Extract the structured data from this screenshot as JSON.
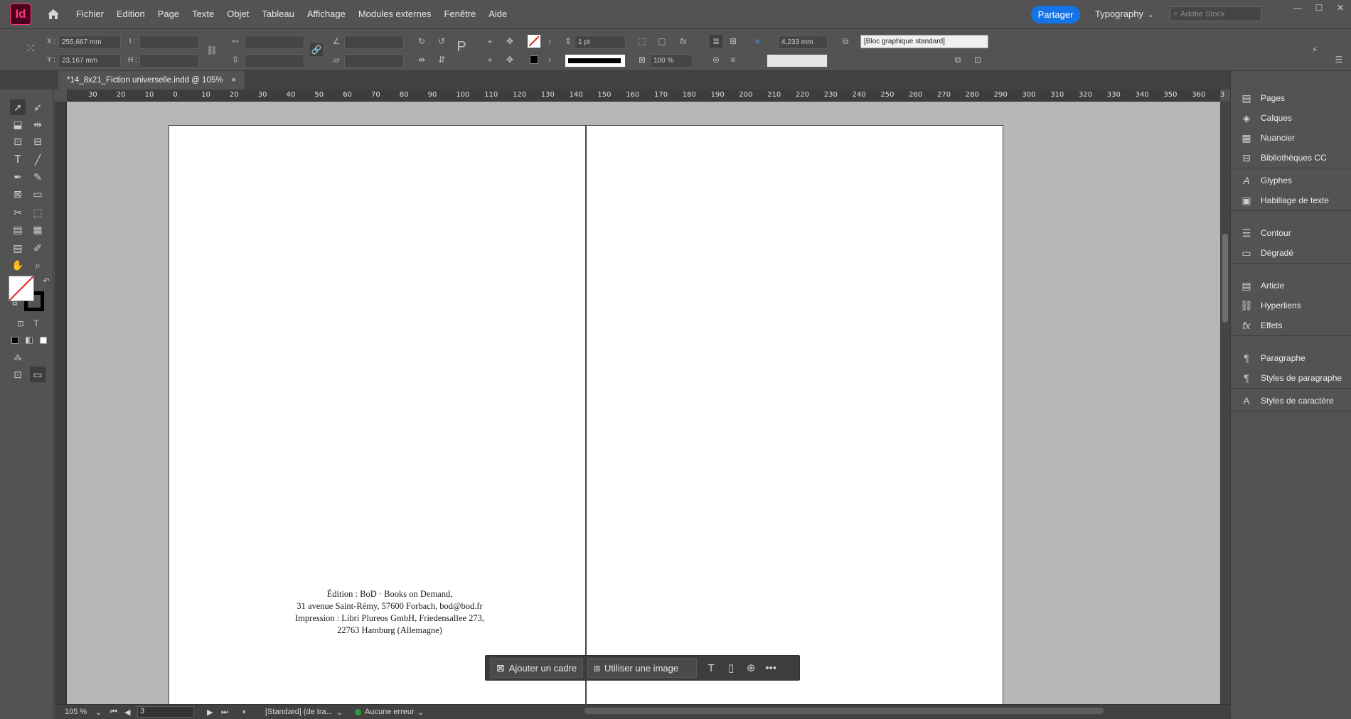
{
  "app": {
    "logo": "Id",
    "menu": [
      "Fichier",
      "Edition",
      "Page",
      "Texte",
      "Objet",
      "Tableau",
      "Affichage",
      "Modules externes",
      "Fenêtre",
      "Aide"
    ],
    "share_label": "Partager",
    "workspace_label": "Typography",
    "stock_placeholder": "Adobe Stock"
  },
  "control": {
    "x_label": "X :",
    "x_value": "255,667 mm",
    "y_label": "Y :",
    "y_value": "23,167 mm",
    "w_label": "l :",
    "h_label": "H :",
    "stroke_weight": "1 pt",
    "opacity": "100 %",
    "offset": "4,233 mm",
    "object_style": "[Bloc graphique standard]"
  },
  "tab": {
    "title": "*14_8x21_Fiction universelle.indd @ 105%",
    "close": "×"
  },
  "ruler": {
    "h_ticks": [
      "30",
      "20",
      "10",
      "0",
      "10",
      "20",
      "30",
      "40",
      "50",
      "60",
      "70",
      "80",
      "90",
      "100",
      "110",
      "120",
      "130",
      "140",
      "150",
      "160",
      "170",
      "180",
      "190",
      "200",
      "210",
      "220",
      "230",
      "240",
      "250",
      "260",
      "270",
      "280",
      "290",
      "300",
      "310",
      "320",
      "330",
      "340",
      "350",
      "360",
      "3"
    ]
  },
  "document": {
    "imprint_lines": [
      "Édition : BoD · Books on Demand,",
      "31 avenue Saint-Rémy, 57600 Forbach, bod@bod.fr",
      "Impression : Libri Plureos GmbH, Friedensallee 273,",
      "22763 Hamburg (Allemagne)"
    ]
  },
  "contextual": {
    "add_frame": "Ajouter un cadre",
    "use_image": "Utiliser une image"
  },
  "status": {
    "zoom": "105 %",
    "page": "3",
    "style": "[Standard] (de tra...",
    "preflight": "Aucune erreur"
  },
  "panels": [
    {
      "label": "Pages",
      "icon": "pages-icon"
    },
    {
      "label": "Calques",
      "icon": "layers-icon"
    },
    {
      "label": "Nuancier",
      "icon": "swatches-icon"
    },
    {
      "label": "Bibliothèques CC",
      "icon": "libraries-icon"
    },
    {
      "label": "Glyphes",
      "icon": "glyphs-icon"
    },
    {
      "label": "Habillage de texte",
      "icon": "text-wrap-icon"
    },
    {
      "label": "Contour",
      "icon": "stroke-icon"
    },
    {
      "label": "Dégradé",
      "icon": "gradient-icon"
    },
    {
      "label": "Article",
      "icon": "article-icon"
    },
    {
      "label": "Hyperliens",
      "icon": "hyperlinks-icon"
    },
    {
      "label": "Effets",
      "icon": "effects-icon"
    },
    {
      "label": "Paragraphe",
      "icon": "paragraph-icon"
    },
    {
      "label": "Styles de paragraphe",
      "icon": "paragraph-styles-icon"
    },
    {
      "label": "Styles de caractère",
      "icon": "character-styles-icon"
    }
  ],
  "colors": {
    "accent": "#1473e6",
    "brand": "#ff3a72",
    "ok": "#2d9d3a"
  }
}
